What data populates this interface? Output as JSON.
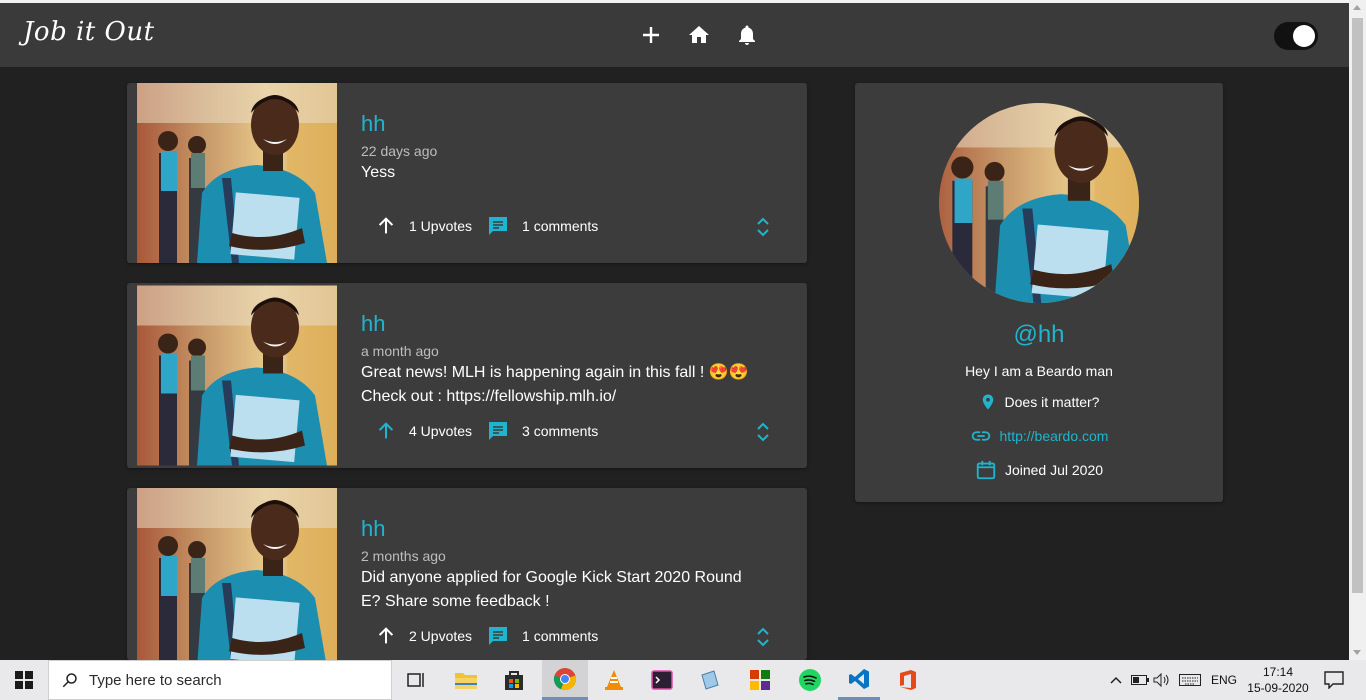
{
  "header": {
    "logo": "Job it Out",
    "icons": [
      "add-icon",
      "home-icon",
      "bell-icon"
    ],
    "theme_toggle": "on"
  },
  "colors": {
    "accent": "#1fb5cf",
    "card_bg": "#3c3c3c",
    "page_bg": "#212121",
    "header_bg": "#3a3a3a"
  },
  "posts": [
    {
      "author": "hh",
      "time": "22 days ago",
      "lines": [
        "Yess"
      ],
      "upvotes": "1 Upvotes",
      "comments": "1 comments",
      "upvoted": false
    },
    {
      "author": "hh",
      "time": "a month ago",
      "lines": [
        "Great news! MLH is happening again in this fall ! 😍😍",
        "Check out : https://fellowship.mlh.io/"
      ],
      "upvotes": "4 Upvotes",
      "comments": "3 comments",
      "upvoted": true
    },
    {
      "author": "hh",
      "time": "2 months ago",
      "lines": [
        "Did anyone applied for Google Kick Start 2020 Round",
        "E? Share some feedback !"
      ],
      "upvotes": "2 Upvotes",
      "comments": "1 comments",
      "upvoted": false
    }
  ],
  "profile": {
    "handle": "@hh",
    "bio": "Hey I am a Beardo man",
    "location": "Does it matter?",
    "website": "http://beardo.com",
    "joined": "Joined Jul 2020"
  },
  "taskbar": {
    "search_placeholder": "Type here to search",
    "language": "ENG",
    "time": "17:14",
    "date": "15-09-2020"
  }
}
